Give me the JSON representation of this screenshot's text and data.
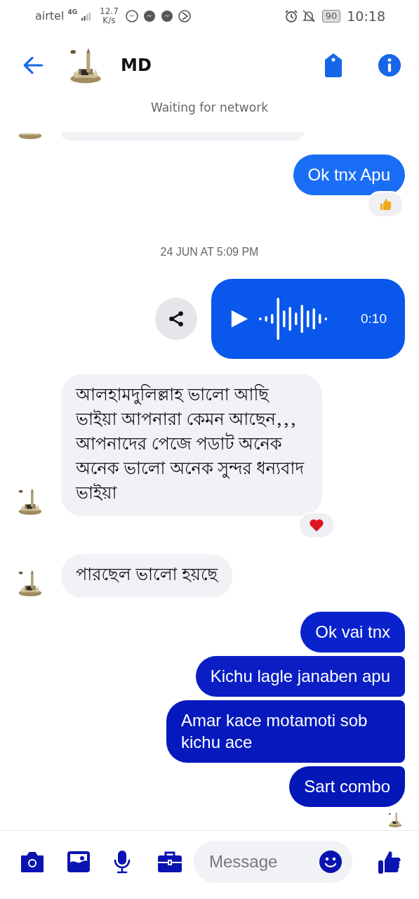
{
  "status_bar": {
    "carrier": "airtel",
    "network_type": "4G",
    "speed_value": "12.7",
    "speed_unit": "K/s",
    "battery": "90",
    "time": "10:18"
  },
  "header": {
    "name": "MD"
  },
  "network_banner": "Waiting for network",
  "messages": [
    {
      "kind": "partial_received"
    },
    {
      "kind": "sent",
      "text": "Ok tnx Apu",
      "color": "#1a6ef5",
      "reaction": {
        "kind": "like"
      }
    },
    {
      "kind": "timestamp",
      "text": "24 JUN AT 5:09 PM"
    },
    {
      "kind": "voice",
      "duration": "0:10",
      "color": "#0a57ec"
    },
    {
      "kind": "received",
      "text": "আলহামদুলিল্লাহ ভালো আছি ভাইয়া আপনারা কেমন আছেন,,, আপনাদের পেজে পডাট অনেক অনেক ভালো  অনেক সুন্দর ধন্যবাদ ভাইয়া",
      "reaction": {
        "kind": "heart"
      }
    },
    {
      "kind": "received",
      "text": "পারছেল ভালো হয়ছে"
    },
    {
      "kind": "sent",
      "text": "Ok vai tnx",
      "color": "#0a22cc"
    },
    {
      "kind": "sent",
      "text": "Kichu lagle janaben apu",
      "color": "#0a1ec4"
    },
    {
      "kind": "sent",
      "text": "Amar kace motamoti sob kichu ace",
      "color": "#0519bd"
    },
    {
      "kind": "sent",
      "text": "Sart combo",
      "color": "#0418b8"
    },
    {
      "kind": "seen_avatar"
    }
  ],
  "composer": {
    "placeholder": "Message"
  }
}
